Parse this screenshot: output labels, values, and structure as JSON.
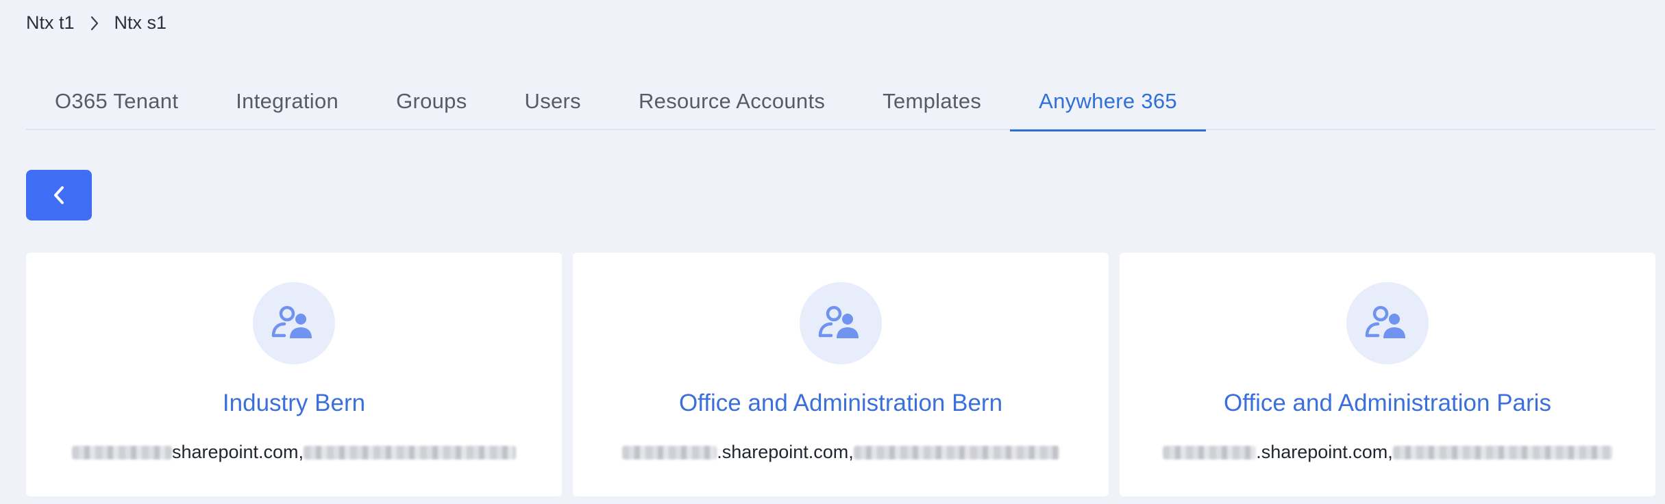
{
  "breadcrumb": {
    "items": [
      "Ntx t1",
      "Ntx s1"
    ]
  },
  "tabs": [
    {
      "label": "O365 Tenant"
    },
    {
      "label": "Integration"
    },
    {
      "label": "Groups"
    },
    {
      "label": "Users"
    },
    {
      "label": "Resource Accounts"
    },
    {
      "label": "Templates"
    },
    {
      "label": "Anywhere 365",
      "active": true
    }
  ],
  "back_button": {
    "icon": "chevron-left-icon"
  },
  "cards": [
    {
      "title": "Industry Bern",
      "url_visible": "sharepoint.com,",
      "icon": "group-users-icon"
    },
    {
      "title": "Office and Administration Bern",
      "url_visible": ".sharepoint.com,",
      "icon": "group-users-icon"
    },
    {
      "title": "Office and Administration Paris",
      "url_visible": ".sharepoint.com,",
      "icon": "group-users-icon"
    }
  ],
  "colors": {
    "accent": "#3f6ef5",
    "link": "#3b6fdc",
    "active_tab": "#2f6fd6",
    "background": "#f0f2fa"
  }
}
